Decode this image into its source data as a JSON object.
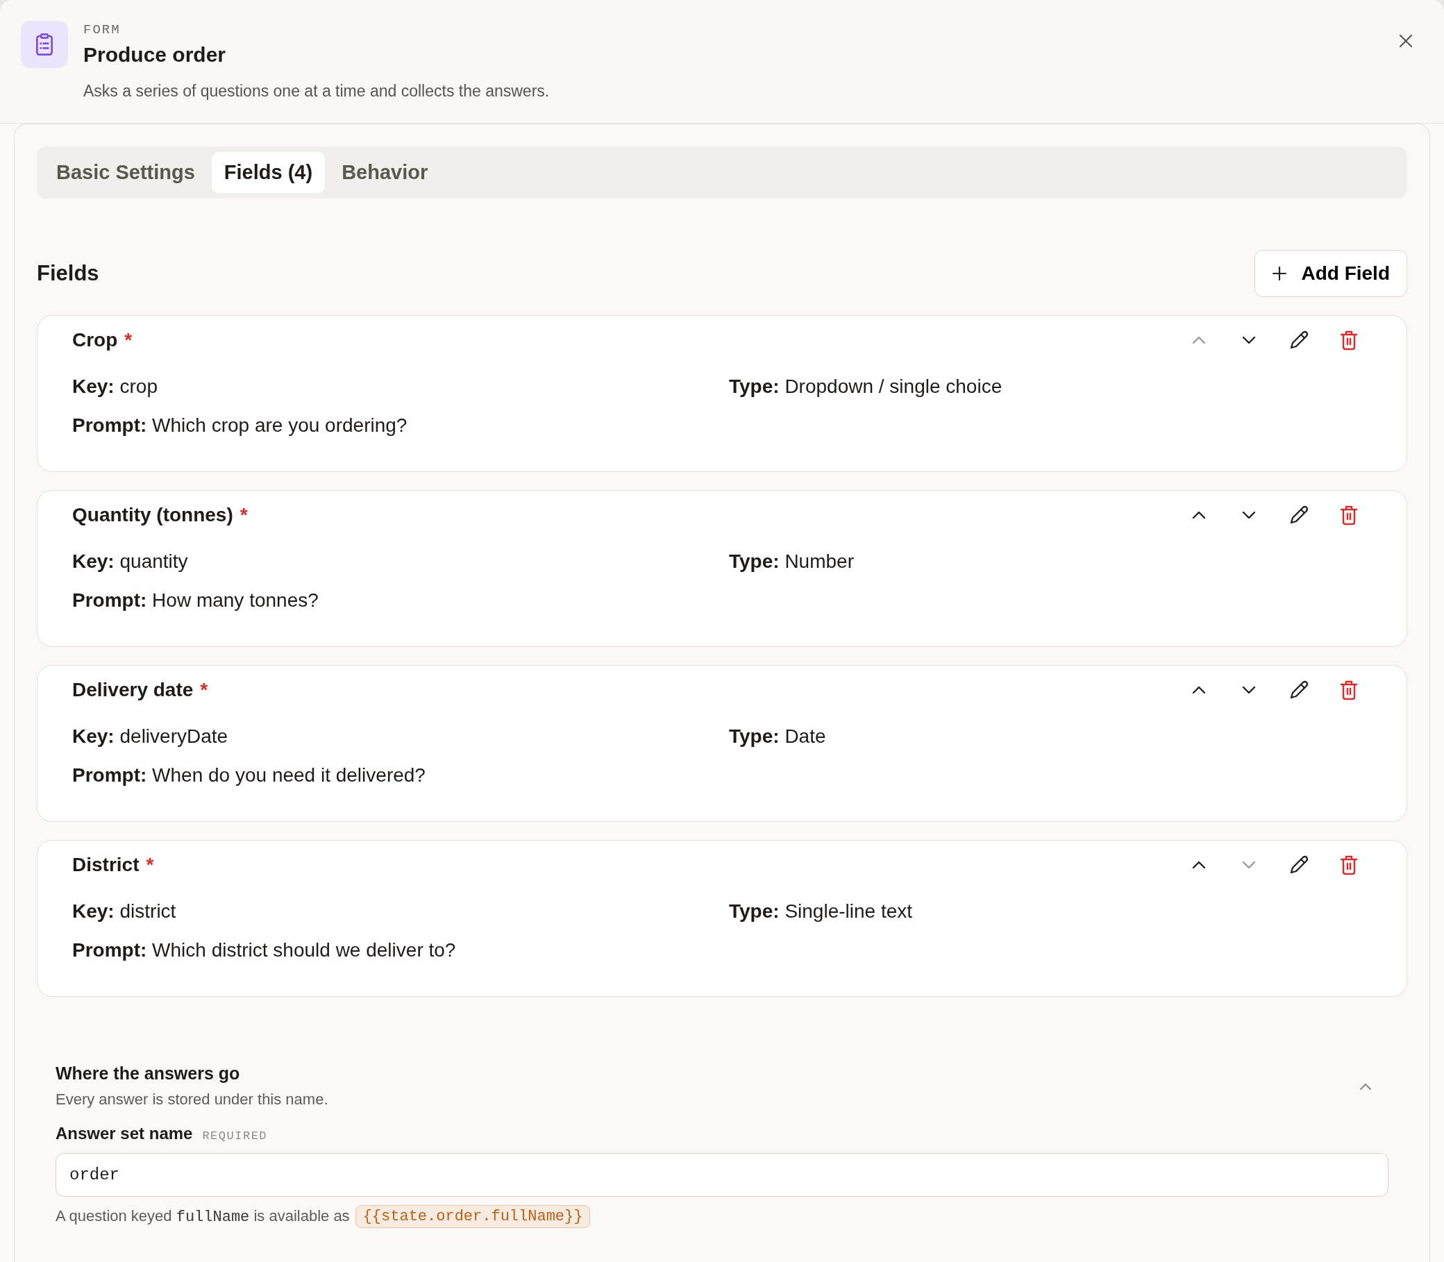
{
  "header": {
    "kind_label": "FORM",
    "title": "Produce order",
    "description": "Asks a series of questions one at a time and collects the answers."
  },
  "tabs": [
    {
      "label": "Basic Settings",
      "selected": false
    },
    {
      "label": "Fields (4)",
      "selected": true
    },
    {
      "label": "Behavior",
      "selected": false
    }
  ],
  "fields_section": {
    "title": "Fields",
    "add_button": "Add Field"
  },
  "fields": [
    {
      "name": "Crop",
      "required_mark": "*",
      "key_label": "Key:",
      "key": "crop",
      "type_label": "Type:",
      "type": "Dropdown / single choice",
      "prompt_label": "Prompt:",
      "prompt": "Which crop are you ordering?",
      "up_disabled": true,
      "down_disabled": false
    },
    {
      "name": "Quantity (tonnes)",
      "required_mark": "*",
      "key_label": "Key:",
      "key": "quantity",
      "type_label": "Type:",
      "type": "Number",
      "prompt_label": "Prompt:",
      "prompt": "How many tonnes?",
      "up_disabled": false,
      "down_disabled": false
    },
    {
      "name": "Delivery date",
      "required_mark": "*",
      "key_label": "Key:",
      "key": "deliveryDate",
      "type_label": "Type:",
      "type": "Date",
      "prompt_label": "Prompt:",
      "prompt": "When do you need it delivered?",
      "up_disabled": false,
      "down_disabled": false
    },
    {
      "name": "District",
      "required_mark": "*",
      "key_label": "Key:",
      "key": "district",
      "type_label": "Type:",
      "type": "Single-line text",
      "prompt_label": "Prompt:",
      "prompt": "Which district should we deliver to?",
      "up_disabled": false,
      "down_disabled": true
    }
  ],
  "answers": {
    "title": "Where the answers go",
    "subtitle": "Every answer is stored under this name.",
    "expanded": true,
    "field_label": "Answer set name",
    "required_tag": "REQUIRED",
    "value": "order",
    "helper_before": "A question keyed",
    "helper_code": "fullName",
    "helper_after": "is available as",
    "token": "{{state.order.fullName}}"
  }
}
